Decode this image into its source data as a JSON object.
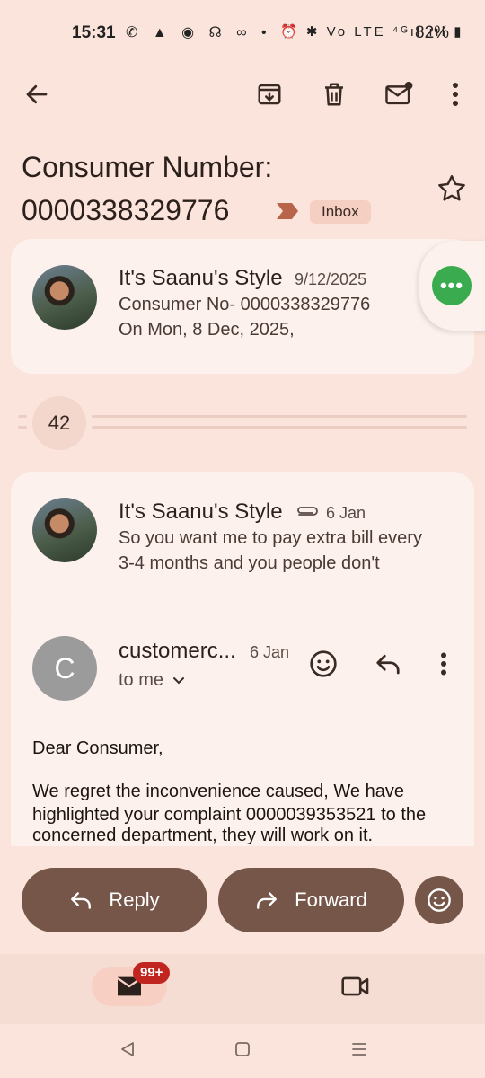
{
  "status_bar": {
    "time": "15:31",
    "left_icons": "✆ ▲ ◉ ☊ ∞ •",
    "right_icons": "⏰ ✱ Vo LTE ⁴ᴳıl ııl ▮",
    "battery": "82%"
  },
  "toolbar": {
    "back_icon": "arrow-back-icon",
    "archive_icon": "archive-icon",
    "delete_icon": "trash-icon",
    "mark_unread_icon": "mail-unread-icon",
    "more_icon": "more-vert-icon"
  },
  "subject": {
    "line1": "Consumer Number:",
    "line2": "0000338329776",
    "label": "Inbox"
  },
  "thread": {
    "first_message": {
      "sender": "It's Saanu's Style",
      "date": "9/12/2025",
      "snippet_line1": "Consumer No- 0000338329776",
      "snippet_line2": "On Mon, 8 Dec, 2025,"
    },
    "collapsed_count": "42",
    "second_message": {
      "sender": "It's Saanu's Style",
      "date": "6 Jan",
      "snippet_line1": "So you want me to pay extra bill every",
      "snippet_line2": "3-4 months and you people don't"
    },
    "expanded_message": {
      "avatar_letter": "C",
      "sender": "customerc...",
      "date": "6 Jan",
      "recipient": "to me",
      "body": [
        "Dear Consumer,",
        "We regret the inconvenience caused, We have",
        "highlighted your complaint 0000039353521 to the",
        "concerned department, they will work on it."
      ]
    }
  },
  "actions": {
    "reply_label": "Reply",
    "forward_label": "Forward"
  },
  "bottom_nav": {
    "mail_badge": "99+"
  },
  "colors": {
    "background": "#fbe4dc",
    "card": "#fdf1ed",
    "button": "#765649",
    "chat_green": "#3aab4f",
    "badge_red": "#c0261f"
  }
}
